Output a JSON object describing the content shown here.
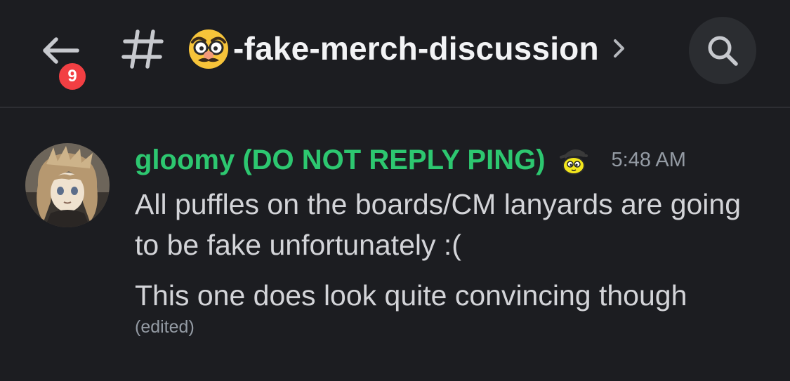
{
  "header": {
    "back_icon": "arrow-left-icon",
    "unread_badge": "9",
    "channel_prefix_icon": "hash-icon",
    "channel_emoji": "disguised-face-emoji",
    "channel_name": "-fake-merch-discussion",
    "chevron_icon": "chevron-right-icon",
    "search_icon": "search-icon"
  },
  "message": {
    "author": "gloomy (DO NOT REPLY PING)",
    "author_color": "#2dc770",
    "role_icon": "yellow-puffle-icon",
    "timestamp": "5:48 AM",
    "lines": [
      "All puffles on the boards/CM lanyards are going to be fake unfortunately :(",
      "This one does look quite convincing though"
    ],
    "edited_label": "(edited)"
  },
  "colors": {
    "background": "#1c1d21",
    "badge": "#f23f43",
    "search_button_bg": "#2b2d31"
  }
}
